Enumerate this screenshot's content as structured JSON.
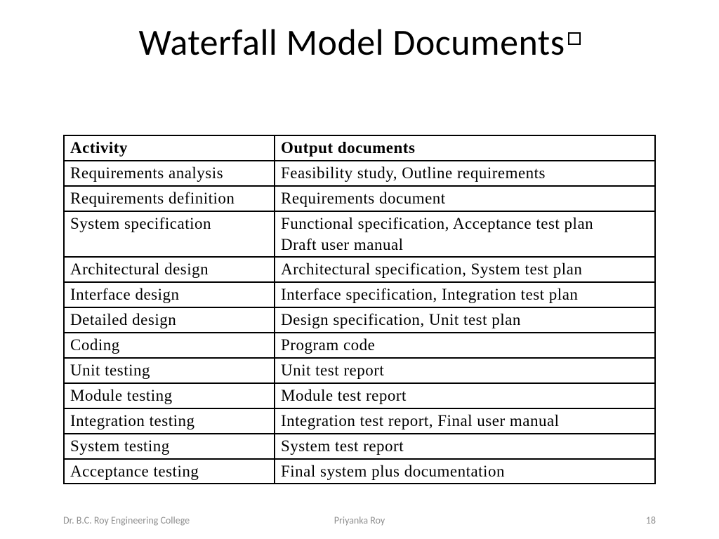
{
  "title": "Waterfall Model Documents",
  "table": {
    "headers": {
      "activity": "Activity",
      "output": "Output documents"
    },
    "rows": [
      {
        "activity": "Requirements analysis",
        "output": "Feasibility study, Outline requirements"
      },
      {
        "activity": "Requirements definition",
        "output": "Requirements document"
      },
      {
        "activity": "System specification",
        "output": "Functional specification, Acceptance test plan\nDraft user manual"
      },
      {
        "activity": "Architectural design",
        "output": "Architectural specification, System test plan"
      },
      {
        "activity": "Interface design",
        "output": "Interface specification, Integration test plan"
      },
      {
        "activity": "Detailed design",
        "output": "Design specification, Unit test plan"
      },
      {
        "activity": "Coding",
        "output": "Program code"
      },
      {
        "activity": "Unit testing",
        "output": "Unit test report"
      },
      {
        "activity": "Module testing",
        "output": "Module test report"
      },
      {
        "activity": "Integration testing",
        "output": "Integration test report, Final user manual"
      },
      {
        "activity": "System testing",
        "output": "System test report"
      },
      {
        "activity": "Acceptance testing",
        "output": "Final system plus documentation"
      }
    ]
  },
  "footer": {
    "left": "Dr. B.C. Roy Engineering College",
    "center": "Priyanka Roy",
    "right": "18"
  }
}
